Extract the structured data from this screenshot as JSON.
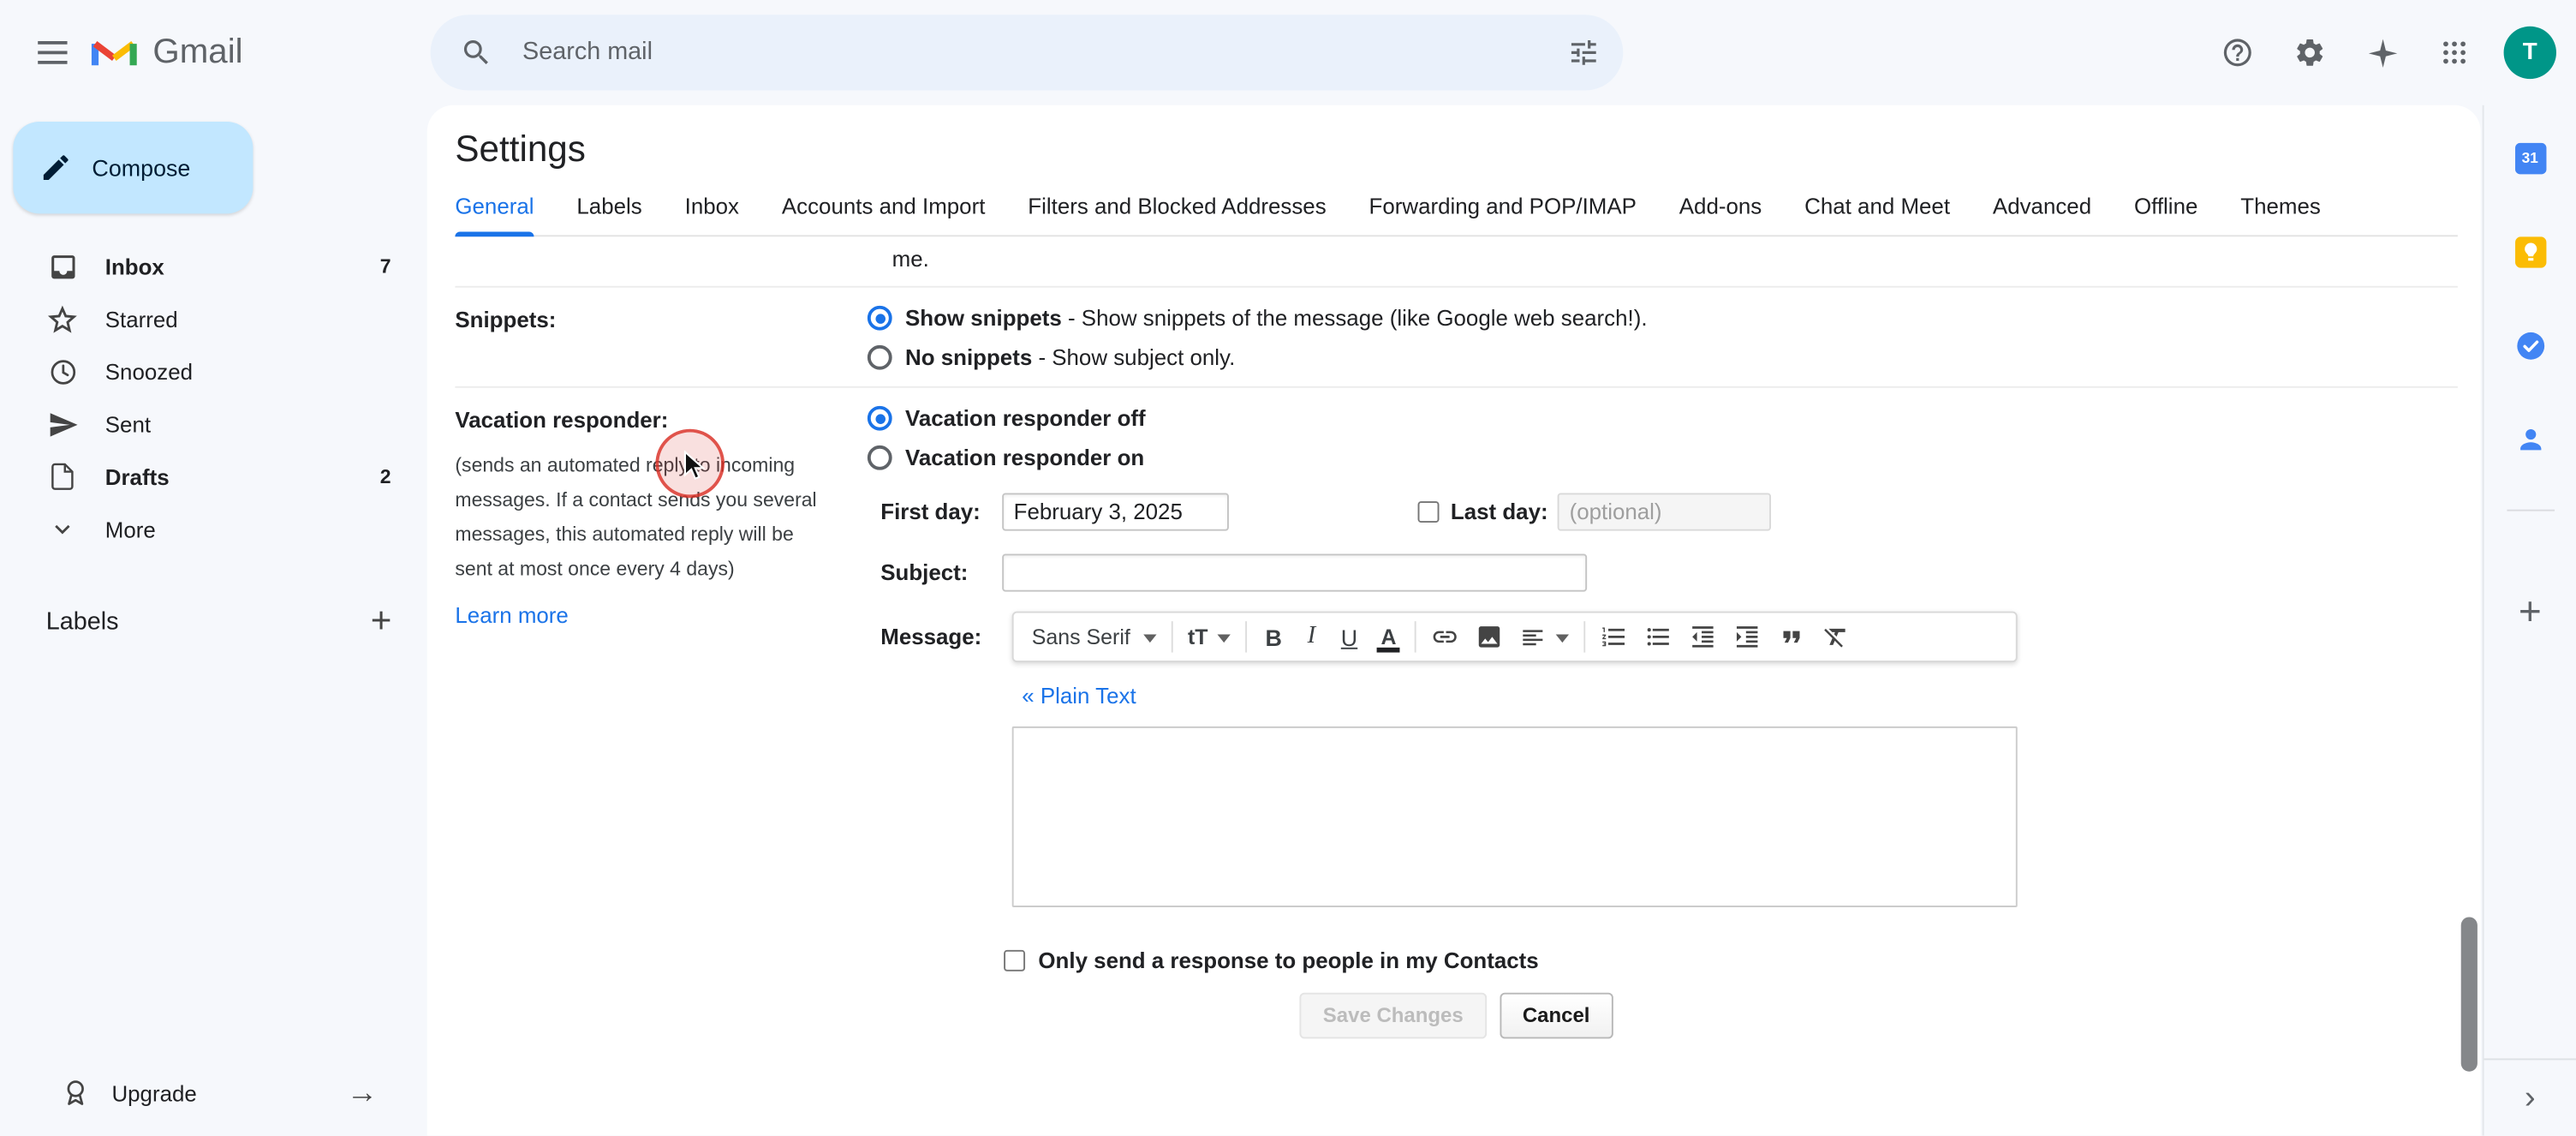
{
  "colors": {
    "accent_blue": "#1a73e8",
    "compose_bg": "#c2e7ff",
    "search_bg": "#eaf1fb",
    "avatar_bg": "#009688"
  },
  "header": {
    "product": "Gmail",
    "search_placeholder": "Search mail",
    "avatar_letter": "T",
    "icons": [
      "menu-icon",
      "gmail-logo",
      "search-icon",
      "tune-icon",
      "help-icon",
      "settings-gear-icon",
      "gemini-sparkle-icon",
      "apps-grid-icon",
      "avatar"
    ]
  },
  "sidebar": {
    "compose_label": "Compose",
    "items": [
      {
        "label": "Inbox",
        "count": "7",
        "icon": "inbox-icon",
        "bold": true
      },
      {
        "label": "Starred",
        "count": "",
        "icon": "star-icon",
        "bold": false
      },
      {
        "label": "Snoozed",
        "count": "",
        "icon": "clock-icon",
        "bold": false
      },
      {
        "label": "Sent",
        "count": "",
        "icon": "send-icon",
        "bold": false
      },
      {
        "label": "Drafts",
        "count": "2",
        "icon": "draft-icon",
        "bold": true
      },
      {
        "label": "More",
        "count": "",
        "icon": "chevron-down-icon",
        "bold": false
      }
    ],
    "labels_heading": "Labels",
    "labels_add_glyph": "+",
    "upgrade_label": "Upgrade",
    "upgrade_arrow_glyph": "→"
  },
  "main": {
    "title": "Settings",
    "tabs": [
      "General",
      "Labels",
      "Inbox",
      "Accounts and Import",
      "Filters and Blocked Addresses",
      "Forwarding and POP/IMAP",
      "Add-ons",
      "Chat and Meet",
      "Advanced",
      "Offline",
      "Themes"
    ],
    "active_tab": "General",
    "partial_row_text": "me.",
    "snippets": {
      "label": "Snippets:",
      "options": [
        {
          "title": "Show snippets",
          "desc": " - Show snippets of the message (like Google web search!).",
          "selected": true
        },
        {
          "title": "No snippets",
          "desc": " - Show subject only.",
          "selected": false
        }
      ]
    },
    "vacation": {
      "label": "Vacation responder:",
      "description": "(sends an automated reply to incoming messages. If a contact sends you several messages, this automated reply will be sent at most once every 4 days)",
      "learn_more": "Learn more",
      "off_option": "Vacation responder off",
      "on_option": "Vacation responder on",
      "selected": "Vacation responder off",
      "first_day_label": "First day:",
      "first_day_value": "February 3, 2025",
      "last_day_label": "Last day:",
      "last_day_checked": false,
      "last_day_placeholder": "(optional)",
      "subject_label": "Subject:",
      "subject_value": "",
      "message_label": "Message:",
      "message_value": "",
      "plain_text_link": "« Plain Text",
      "contacts_option": "Only send a response to people in my Contacts",
      "contacts_checked": false
    },
    "toolbar": {
      "font_name": "Sans Serif",
      "size_glyph": "tT",
      "bold_glyph": "B",
      "italic_glyph": "I",
      "underline_glyph": "U",
      "color_glyph": "A",
      "icons": [
        "font-family",
        "font-size",
        "bold",
        "italic",
        "underline",
        "text-color",
        "insert-link",
        "insert-image",
        "align",
        "numbered-list",
        "bulleted-list",
        "indent-less",
        "indent-more",
        "quote",
        "remove-formatting"
      ]
    },
    "buttons": {
      "save": "Save Changes",
      "cancel": "Cancel"
    }
  },
  "right_rail": {
    "icons": [
      "calendar-icon",
      "keep-icon",
      "tasks-icon",
      "contacts-icon",
      "plus-icon",
      "chevron-right-icon"
    ],
    "calendar_text": "31",
    "plus_glyph": "+",
    "chevron_glyph": "›"
  }
}
